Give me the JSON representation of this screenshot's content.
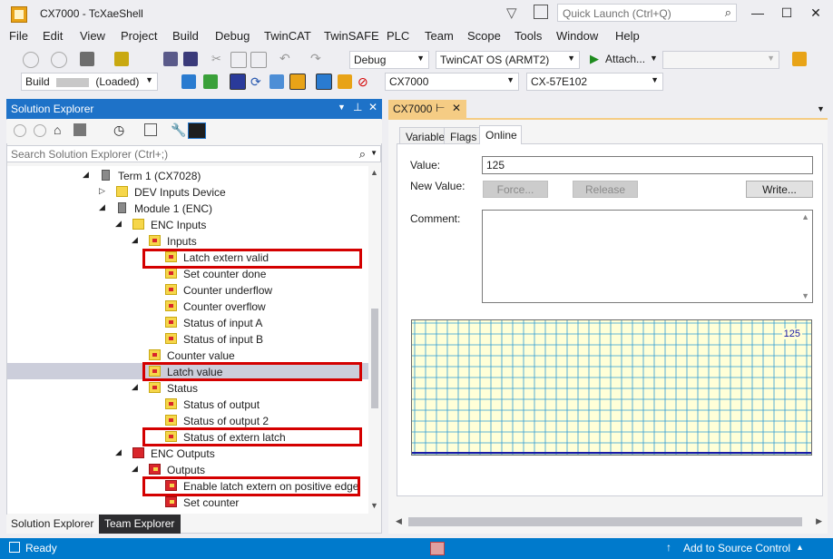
{
  "window": {
    "title": "CX7000 - TcXaeShell",
    "quick_launch_placeholder": "Quick Launch (Ctrl+Q)"
  },
  "menu": [
    "File",
    "Edit",
    "View",
    "Project",
    "Build",
    "Debug",
    "TwinCAT",
    "TwinSAFE",
    "PLC",
    "Team",
    "Scope",
    "Tools",
    "Window",
    "Help"
  ],
  "toolbar1": {
    "config": "Debug",
    "platform": "TwinCAT OS (ARMT2)",
    "attach": "Attach...",
    "icons": [
      "back-icon",
      "forward-icon",
      "new-project-icon",
      "open-icon",
      "save-icon",
      "save-all-icon",
      "cut-icon",
      "copy-icon",
      "paste-icon",
      "undo-icon",
      "redo-icon",
      "start-icon",
      "search-icon"
    ]
  },
  "toolbar2": {
    "build_label": "Build",
    "build_state": "(Loaded)",
    "target": "CX7000",
    "netid": "CX-57E102"
  },
  "solution_explorer": {
    "title": "Solution Explorer",
    "search_placeholder": "Search Solution Explorer (Ctrl+;)",
    "tree": [
      {
        "label": "Term 1 (CX7028)",
        "icon": "terminal-icon",
        "expander": "open"
      },
      {
        "label": "DEV Inputs Device",
        "icon": "folder-icon",
        "expander": "closed"
      },
      {
        "label": "Module 1 (ENC)",
        "icon": "terminal-icon",
        "expander": "open"
      },
      {
        "label": "ENC Inputs",
        "icon": "input-folder-icon",
        "expander": "open"
      },
      {
        "label": "Inputs",
        "icon": "input-var-icon",
        "expander": "open"
      },
      {
        "label": "Latch extern valid",
        "icon": "input-var-icon",
        "highlighted": true
      },
      {
        "label": "Set counter done",
        "icon": "input-var-icon"
      },
      {
        "label": "Counter underflow",
        "icon": "input-var-icon"
      },
      {
        "label": "Counter overflow",
        "icon": "input-var-icon"
      },
      {
        "label": "Status of input A",
        "icon": "input-var-icon"
      },
      {
        "label": "Status of input B",
        "icon": "input-var-icon"
      },
      {
        "label": "Counter value",
        "icon": "input-var-icon"
      },
      {
        "label": "Latch value",
        "icon": "input-var-icon",
        "highlighted": true,
        "selected": true
      },
      {
        "label": "Status",
        "icon": "input-var-icon",
        "expander": "open"
      },
      {
        "label": "Status of output",
        "icon": "input-var-icon"
      },
      {
        "label": "Status of output 2",
        "icon": "input-var-icon"
      },
      {
        "label": "Status of extern latch",
        "icon": "input-var-icon",
        "highlighted": true
      },
      {
        "label": "ENC Outputs",
        "icon": "output-folder-icon",
        "expander": "open"
      },
      {
        "label": "Outputs",
        "icon": "output-var-icon",
        "expander": "open"
      },
      {
        "label": "Enable latch extern on positive edge",
        "icon": "output-var-icon",
        "highlighted": true
      },
      {
        "label": "Set counter",
        "icon": "output-var-icon"
      }
    ],
    "bottom_tabs": [
      "Solution Explorer",
      "Team Explorer"
    ]
  },
  "document": {
    "tab": "CX7000",
    "inner_tabs": [
      "Variable",
      "Flags",
      "Online"
    ],
    "active_inner_tab": "Online",
    "value_label": "Value:",
    "value": "125",
    "new_value_label": "New Value:",
    "force_button": "Force...",
    "release_button": "Release",
    "write_button": "Write...",
    "comment_label": "Comment:",
    "chart_value": "125"
  },
  "statusbar": {
    "ready": "Ready",
    "source_control": "Add to Source Control"
  },
  "colors": {
    "accent": "#007acc",
    "selection_blue": "#1e72c8",
    "highlight_red": "#d40000",
    "doc_tab": "#f5cc84",
    "chart_bg": "#ffffd8",
    "chart_grid": "#2e9bd6",
    "chart_line": "#1a1aa6"
  }
}
